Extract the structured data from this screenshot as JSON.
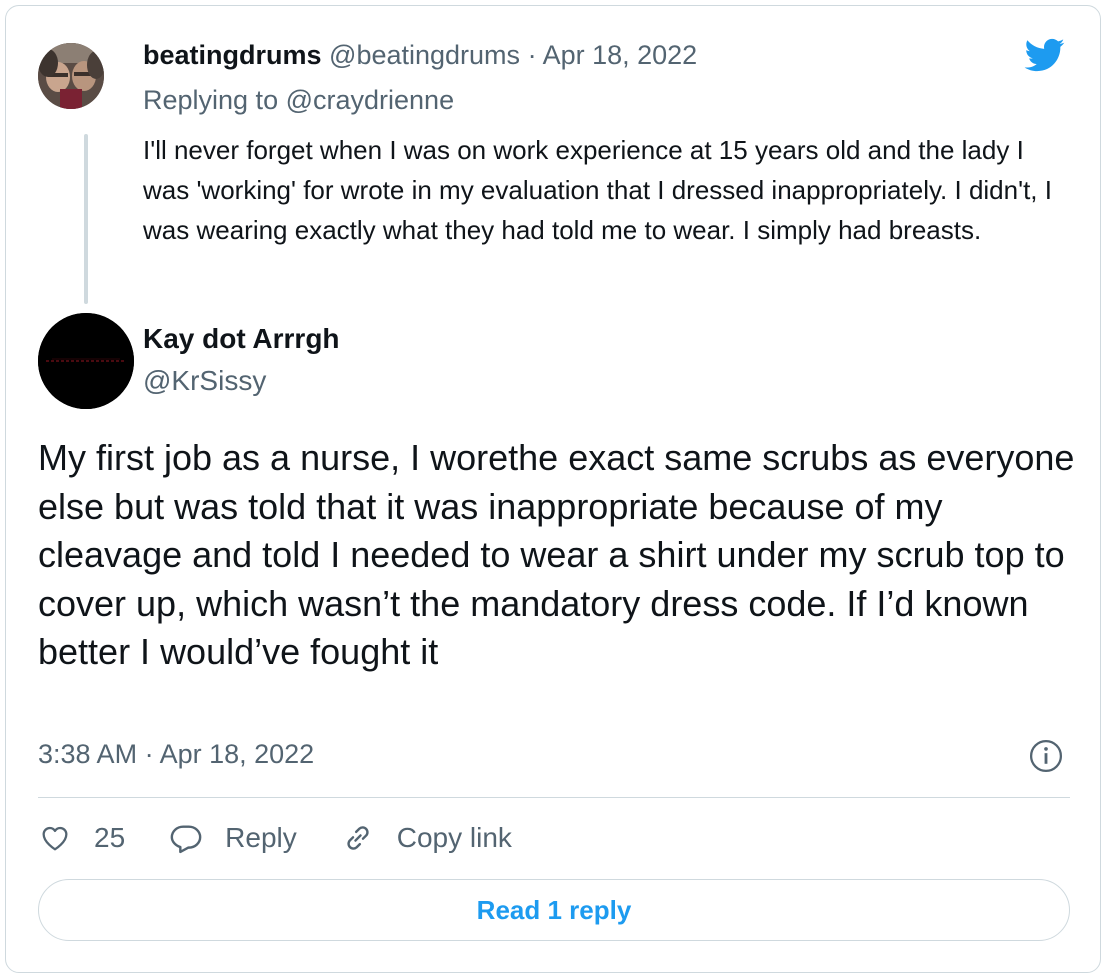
{
  "parent_tweet": {
    "display_name": "beatingdrums",
    "handle": "@beatingdrums",
    "date_sep": " · ",
    "date": "Apr 18, 2022",
    "replying_prefix": "Replying to ",
    "replying_to": "@craydrienne",
    "text": "I'll never forget when I was on work experience at 15 years old and the lady I was 'working' for wrote in my evaluation that I dressed inappropriately. I didn't, I was wearing exactly what they had told me to wear. I simply had breasts."
  },
  "reply_tweet": {
    "display_name": "Kay dot Arrrgh",
    "handle": "@KrSissy",
    "text": "My first job as a nurse, I worethe exact same scrubs as everyone else but was told that it was inappropriate because of my cleavage and told I needed to wear a shirt under my scrub top to cover up, which wasn’t the mandatory dress code. If I’d known better I would’ve fought it",
    "timestamp": "3:38 AM · Apr 18, 2022"
  },
  "actions": {
    "like_count": "25",
    "reply_label": "Reply",
    "copy_link_label": "Copy link"
  },
  "read_replies_label": "Read 1 reply",
  "colors": {
    "brand_blue": "#1d9bf0",
    "muted_text": "#536471",
    "border": "#cfd9de",
    "text": "#0f1419"
  },
  "icons": [
    "twitter-bird-icon",
    "info-icon",
    "heart-icon",
    "reply-bubble-icon",
    "link-icon"
  ]
}
